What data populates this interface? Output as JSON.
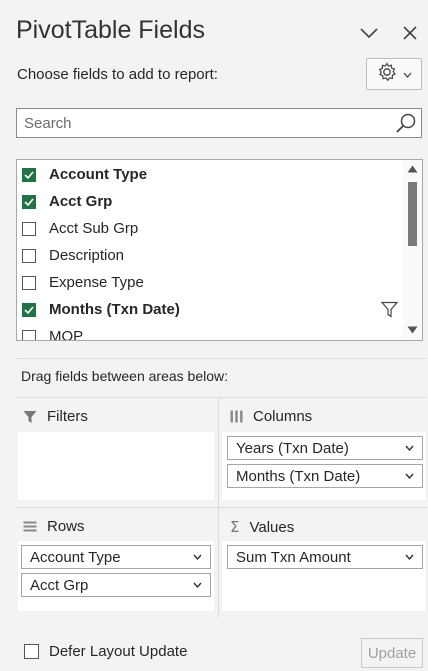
{
  "header": {
    "title": "PivotTable Fields",
    "collapse_icon": "chevron-down-icon",
    "close_icon": "close-icon"
  },
  "choose_label": "Choose fields to add to report:",
  "settings": {
    "icon": "gear-icon",
    "dropdown_icon": "chevron-down-icon"
  },
  "search": {
    "placeholder": "Search",
    "value": ""
  },
  "fields": [
    {
      "label": "Account Type",
      "checked": true
    },
    {
      "label": "Acct Grp",
      "checked": true
    },
    {
      "label": "Acct Sub Grp",
      "checked": false
    },
    {
      "label": "Description",
      "checked": false
    },
    {
      "label": "Expense Type",
      "checked": false
    },
    {
      "label": "Months (Txn Date)",
      "checked": true,
      "filter_icon": "filter-icon"
    },
    {
      "label": "MOP",
      "checked": false
    }
  ],
  "drag_label": "Drag fields between areas below:",
  "areas": {
    "filters": {
      "label": "Filters",
      "icon": "filter-icon",
      "items": []
    },
    "columns": {
      "label": "Columns",
      "icon": "columns-icon",
      "items": [
        "Years (Txn Date)",
        "Months (Txn Date)"
      ]
    },
    "rows": {
      "label": "Rows",
      "icon": "rows-icon",
      "items": [
        "Account Type",
        "Acct Grp"
      ]
    },
    "values": {
      "label": "Values",
      "icon": "sigma-icon",
      "items": [
        "Sum Txn Amount"
      ]
    }
  },
  "footer": {
    "defer_label": "Defer Layout Update",
    "defer_checked": false,
    "update_label": "Update"
  },
  "colors": {
    "accent": "#217346",
    "background": "#f3f3f3"
  }
}
